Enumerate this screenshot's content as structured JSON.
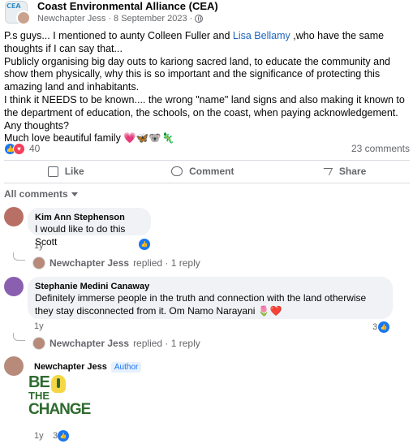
{
  "post": {
    "group_name": "Coast Environmental Alliance (CEA)",
    "author": "Newchapter Jess",
    "date": "8 September 2023",
    "separator": "·",
    "body_line1_a": "P.s guys... I mentioned to aunty Colleen Fuller  and ",
    "mention": "Lisa Bellamy",
    "body_line1_b": " ,who have the same thoughts if I can say that...",
    "body_line2": "Publicly organising big day outs to kariong sacred land, to educate the community and show them physically, why this is so important and the significance of protecting this amazing land and inhabitants.",
    "body_line3": "I think it NEEDS to be known.... the wrong \"name\" land signs and also making it known to the department of education, the schools, on the coast, when paying acknowledgement.",
    "body_line4": "Any thoughts?",
    "body_line5": "Much love beautiful family 💗🦋🐨🦎"
  },
  "stats": {
    "reactions_count": "40",
    "comments_count": "23 comments"
  },
  "actions": {
    "like": "Like",
    "comment": "Comment",
    "share": "Share"
  },
  "comments_filter": "All comments",
  "comments": [
    {
      "name": "Kim Ann Stephenson",
      "text": "I would like to do this Scott",
      "time": "1y",
      "reply_author": "Newchapter Jess",
      "reply_text": "replied · 1 reply"
    },
    {
      "name": "Stephanie Medini Canaway",
      "text": "Definitely immerse people in the truth and connection with the land otherwise they stay disconnected from it. Om Namo Narayani 🌷❤️",
      "time": "1y",
      "likes": "3",
      "reply_author": "Newchapter Jess",
      "reply_text": "replied · 1 reply"
    },
    {
      "name": "Newchapter Jess",
      "badge": "Author",
      "time": "1y",
      "likes": "3",
      "sticker_line1": "BE",
      "sticker_line2": "THE",
      "sticker_line3": "CHANGE"
    }
  ],
  "colors": {
    "link": "#1d65c1",
    "facebook_blue": "#1877f2",
    "love_red": "#f33e58",
    "bubble_bg": "#f0f2f5",
    "muted_text": "#65676b"
  }
}
